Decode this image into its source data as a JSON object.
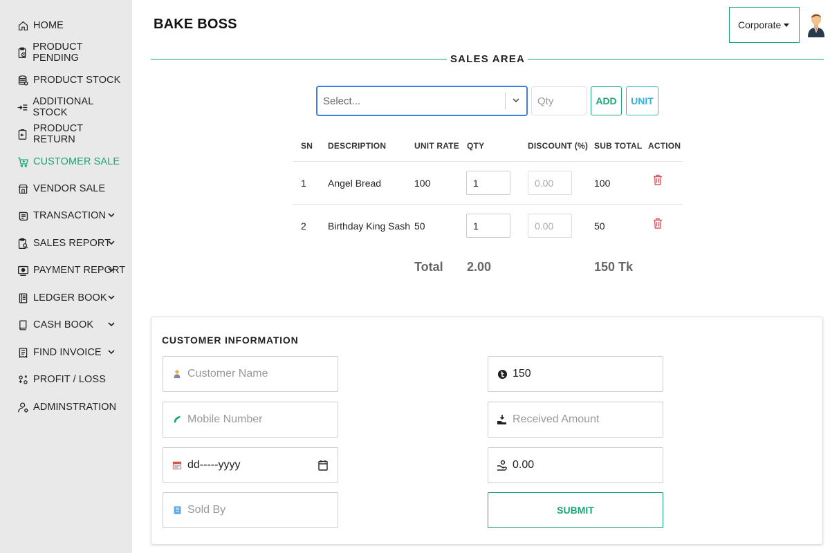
{
  "sidebar": {
    "items": [
      {
        "label": "HOME",
        "icon": "home-icon"
      },
      {
        "label": "PRODUCT PENDING",
        "icon": "clipboard-clock-icon"
      },
      {
        "label": "PRODUCT STOCK",
        "icon": "database-icon"
      },
      {
        "label": "ADDITIONAL STOCK",
        "icon": "list-add-icon"
      },
      {
        "label": "PRODUCT RETURN",
        "icon": "return-box-icon"
      },
      {
        "label": "CUSTOMER SALE",
        "icon": "cart-icon",
        "active": true
      },
      {
        "label": "VENDOR SALE",
        "icon": "store-icon"
      },
      {
        "label": "TRANSACTION",
        "icon": "coins-icon",
        "expandable": true
      },
      {
        "label": "SALES REPORT",
        "icon": "report-search-icon",
        "expandable": true
      },
      {
        "label": "PAYMENT REPORT",
        "icon": "payment-icon",
        "expandable": true
      },
      {
        "label": "LEDGER BOOK",
        "icon": "ledger-icon",
        "expandable": true
      },
      {
        "label": "CASH BOOK",
        "icon": "book-icon",
        "expandable": true
      },
      {
        "label": "FIND INVOICE",
        "icon": "invoice-icon",
        "expandable": true
      },
      {
        "label": "PROFIT / LOSS",
        "icon": "profit-icon"
      },
      {
        "label": "ADMINSTRATION",
        "icon": "user-settings-icon"
      }
    ]
  },
  "header": {
    "brand": "BAKE BOSS",
    "account_select": "Corporate"
  },
  "sales_area": {
    "title": "SALES AREA",
    "product_select_placeholder": "Select...",
    "qty_placeholder": "Qty",
    "add_label": "ADD",
    "unit_label": "UNIT",
    "columns": [
      "SN",
      "DESCRIPTION",
      "UNIT RATE",
      "QTY",
      "DISCOUNT (%)",
      "SUB TOTAL",
      "ACTION"
    ],
    "rows": [
      {
        "sn": "1",
        "description": "Angel Bread",
        "unit_rate": "100",
        "qty": "1",
        "discount_placeholder": "0.00",
        "sub_total": "100"
      },
      {
        "sn": "2",
        "description": "Birthday King Sash",
        "unit_rate": "50",
        "qty": "1",
        "discount_placeholder": "0.00",
        "sub_total": "50"
      }
    ],
    "total_label": "Total",
    "total_qty": "2.00",
    "total_amount": "150 Tk"
  },
  "customer_info": {
    "title": "CUSTOMER INFORMATION",
    "customer_name_placeholder": "Customer Name",
    "mobile_placeholder": "Mobile Number",
    "date_placeholder": "dd-----yyyy",
    "sold_by_placeholder": "Sold By",
    "amount_value": "150",
    "received_placeholder": "Received Amount",
    "change_value": "0.00",
    "submit_label": "SUBMIT"
  },
  "colors": {
    "accent": "#1aa575",
    "info": "#36b3d9",
    "danger": "#e0525b",
    "focus": "#3c7fe0"
  }
}
